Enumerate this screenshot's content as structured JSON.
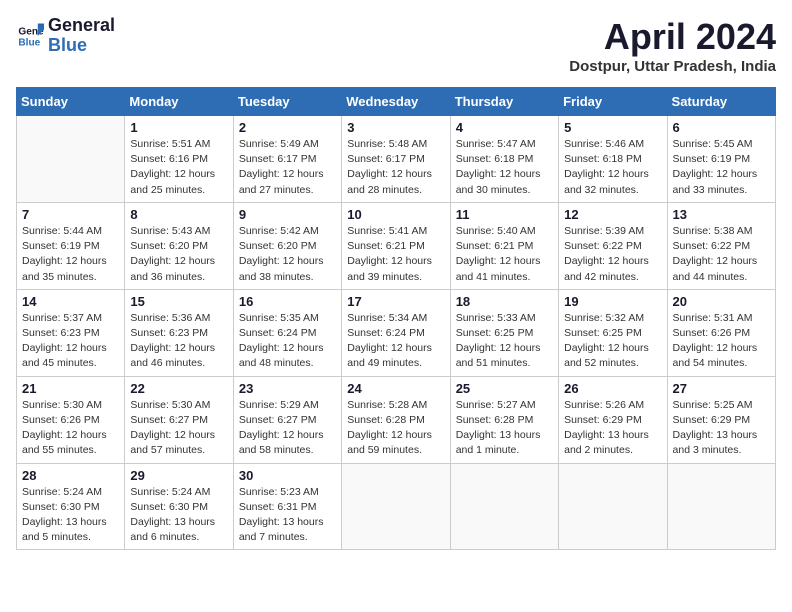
{
  "header": {
    "logo_line1": "General",
    "logo_line2": "Blue",
    "month_title": "April 2024",
    "location": "Dostpur, Uttar Pradesh, India"
  },
  "columns": [
    "Sunday",
    "Monday",
    "Tuesday",
    "Wednesday",
    "Thursday",
    "Friday",
    "Saturday"
  ],
  "weeks": [
    [
      {
        "day": "",
        "info": ""
      },
      {
        "day": "1",
        "info": "Sunrise: 5:51 AM\nSunset: 6:16 PM\nDaylight: 12 hours\nand 25 minutes."
      },
      {
        "day": "2",
        "info": "Sunrise: 5:49 AM\nSunset: 6:17 PM\nDaylight: 12 hours\nand 27 minutes."
      },
      {
        "day": "3",
        "info": "Sunrise: 5:48 AM\nSunset: 6:17 PM\nDaylight: 12 hours\nand 28 minutes."
      },
      {
        "day": "4",
        "info": "Sunrise: 5:47 AM\nSunset: 6:18 PM\nDaylight: 12 hours\nand 30 minutes."
      },
      {
        "day": "5",
        "info": "Sunrise: 5:46 AM\nSunset: 6:18 PM\nDaylight: 12 hours\nand 32 minutes."
      },
      {
        "day": "6",
        "info": "Sunrise: 5:45 AM\nSunset: 6:19 PM\nDaylight: 12 hours\nand 33 minutes."
      }
    ],
    [
      {
        "day": "7",
        "info": "Sunrise: 5:44 AM\nSunset: 6:19 PM\nDaylight: 12 hours\nand 35 minutes."
      },
      {
        "day": "8",
        "info": "Sunrise: 5:43 AM\nSunset: 6:20 PM\nDaylight: 12 hours\nand 36 minutes."
      },
      {
        "day": "9",
        "info": "Sunrise: 5:42 AM\nSunset: 6:20 PM\nDaylight: 12 hours\nand 38 minutes."
      },
      {
        "day": "10",
        "info": "Sunrise: 5:41 AM\nSunset: 6:21 PM\nDaylight: 12 hours\nand 39 minutes."
      },
      {
        "day": "11",
        "info": "Sunrise: 5:40 AM\nSunset: 6:21 PM\nDaylight: 12 hours\nand 41 minutes."
      },
      {
        "day": "12",
        "info": "Sunrise: 5:39 AM\nSunset: 6:22 PM\nDaylight: 12 hours\nand 42 minutes."
      },
      {
        "day": "13",
        "info": "Sunrise: 5:38 AM\nSunset: 6:22 PM\nDaylight: 12 hours\nand 44 minutes."
      }
    ],
    [
      {
        "day": "14",
        "info": "Sunrise: 5:37 AM\nSunset: 6:23 PM\nDaylight: 12 hours\nand 45 minutes."
      },
      {
        "day": "15",
        "info": "Sunrise: 5:36 AM\nSunset: 6:23 PM\nDaylight: 12 hours\nand 46 minutes."
      },
      {
        "day": "16",
        "info": "Sunrise: 5:35 AM\nSunset: 6:24 PM\nDaylight: 12 hours\nand 48 minutes."
      },
      {
        "day": "17",
        "info": "Sunrise: 5:34 AM\nSunset: 6:24 PM\nDaylight: 12 hours\nand 49 minutes."
      },
      {
        "day": "18",
        "info": "Sunrise: 5:33 AM\nSunset: 6:25 PM\nDaylight: 12 hours\nand 51 minutes."
      },
      {
        "day": "19",
        "info": "Sunrise: 5:32 AM\nSunset: 6:25 PM\nDaylight: 12 hours\nand 52 minutes."
      },
      {
        "day": "20",
        "info": "Sunrise: 5:31 AM\nSunset: 6:26 PM\nDaylight: 12 hours\nand 54 minutes."
      }
    ],
    [
      {
        "day": "21",
        "info": "Sunrise: 5:30 AM\nSunset: 6:26 PM\nDaylight: 12 hours\nand 55 minutes."
      },
      {
        "day": "22",
        "info": "Sunrise: 5:30 AM\nSunset: 6:27 PM\nDaylight: 12 hours\nand 57 minutes."
      },
      {
        "day": "23",
        "info": "Sunrise: 5:29 AM\nSunset: 6:27 PM\nDaylight: 12 hours\nand 58 minutes."
      },
      {
        "day": "24",
        "info": "Sunrise: 5:28 AM\nSunset: 6:28 PM\nDaylight: 12 hours\nand 59 minutes."
      },
      {
        "day": "25",
        "info": "Sunrise: 5:27 AM\nSunset: 6:28 PM\nDaylight: 13 hours\nand 1 minute."
      },
      {
        "day": "26",
        "info": "Sunrise: 5:26 AM\nSunset: 6:29 PM\nDaylight: 13 hours\nand 2 minutes."
      },
      {
        "day": "27",
        "info": "Sunrise: 5:25 AM\nSunset: 6:29 PM\nDaylight: 13 hours\nand 3 minutes."
      }
    ],
    [
      {
        "day": "28",
        "info": "Sunrise: 5:24 AM\nSunset: 6:30 PM\nDaylight: 13 hours\nand 5 minutes."
      },
      {
        "day": "29",
        "info": "Sunrise: 5:24 AM\nSunset: 6:30 PM\nDaylight: 13 hours\nand 6 minutes."
      },
      {
        "day": "30",
        "info": "Sunrise: 5:23 AM\nSunset: 6:31 PM\nDaylight: 13 hours\nand 7 minutes."
      },
      {
        "day": "",
        "info": ""
      },
      {
        "day": "",
        "info": ""
      },
      {
        "day": "",
        "info": ""
      },
      {
        "day": "",
        "info": ""
      }
    ]
  ]
}
